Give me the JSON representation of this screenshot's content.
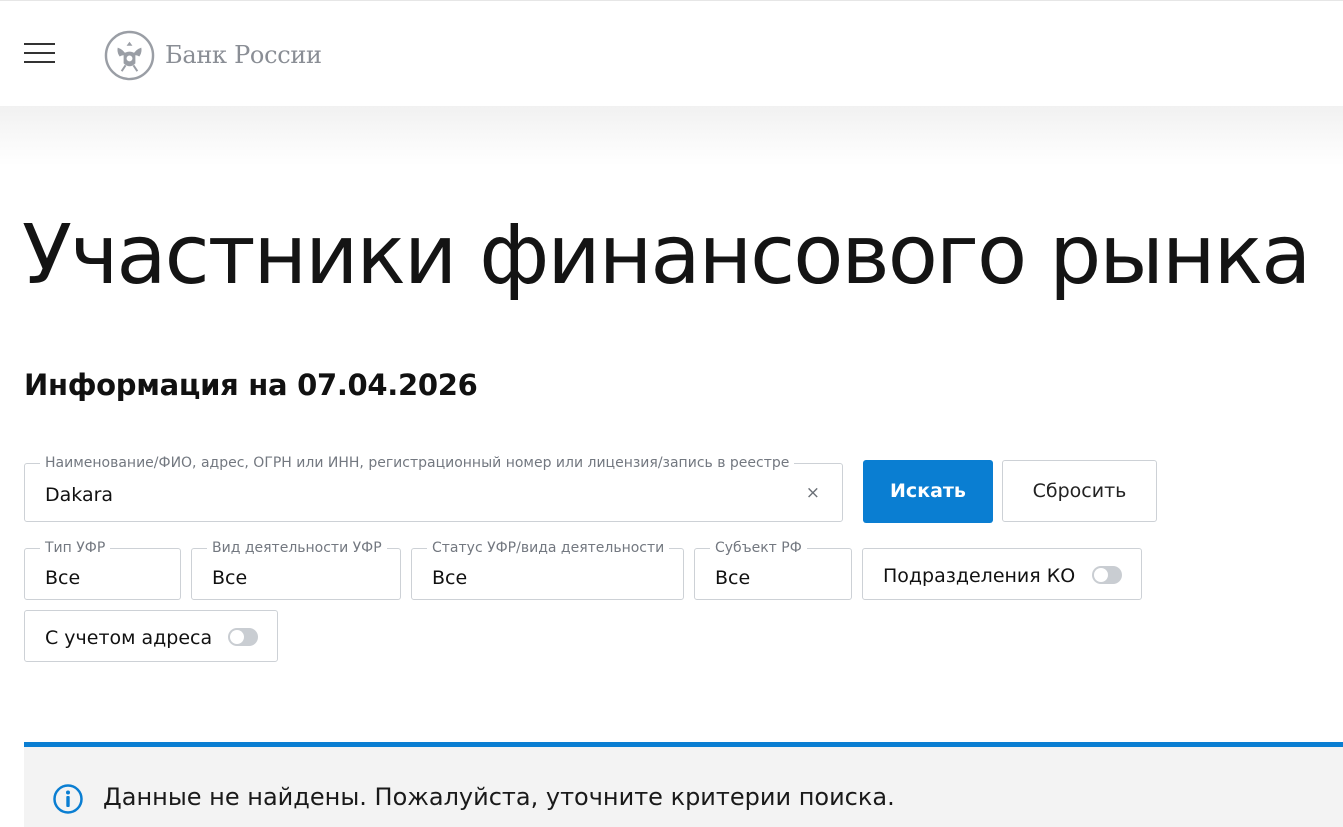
{
  "header": {
    "menu_icon": "hamburger-menu-icon",
    "logo_icon": "double-headed-eagle-emblem-icon",
    "logo_text": "Банк России"
  },
  "main": {
    "title": "Участники финансового рынка",
    "info_date": "Информация на 07.04.2026"
  },
  "search": {
    "legend": "Наименование/ФИО, адрес, ОГРН или ИНН, регистрационный номер или лицензия/запись в реестре",
    "value": "Dakara",
    "clear_icon": "×",
    "search_button": "Искать",
    "reset_button": "Сбросить"
  },
  "filters": {
    "type": {
      "legend": "Тип УФР",
      "value": "Все"
    },
    "kind": {
      "legend": "Вид деятельности УФР",
      "value": "Все"
    },
    "status": {
      "legend": "Статус УФР/вида деятельности",
      "value": "Все"
    },
    "region": {
      "legend": "Субъект РФ",
      "value": "Все"
    },
    "branches_toggle": {
      "label": "Подразделения КО",
      "on": false
    },
    "address_toggle": {
      "label": "С учетом адреса",
      "on": false
    }
  },
  "notice": {
    "icon": "info-circle-icon",
    "text": "Данные не найдены. Пожалуйста, уточните критерии поиска."
  },
  "colors": {
    "accent": "#0a7ed2",
    "notice_bg": "#f3f3f3",
    "border": "#cdd1d6",
    "logo_gray": "#8a8e95"
  }
}
